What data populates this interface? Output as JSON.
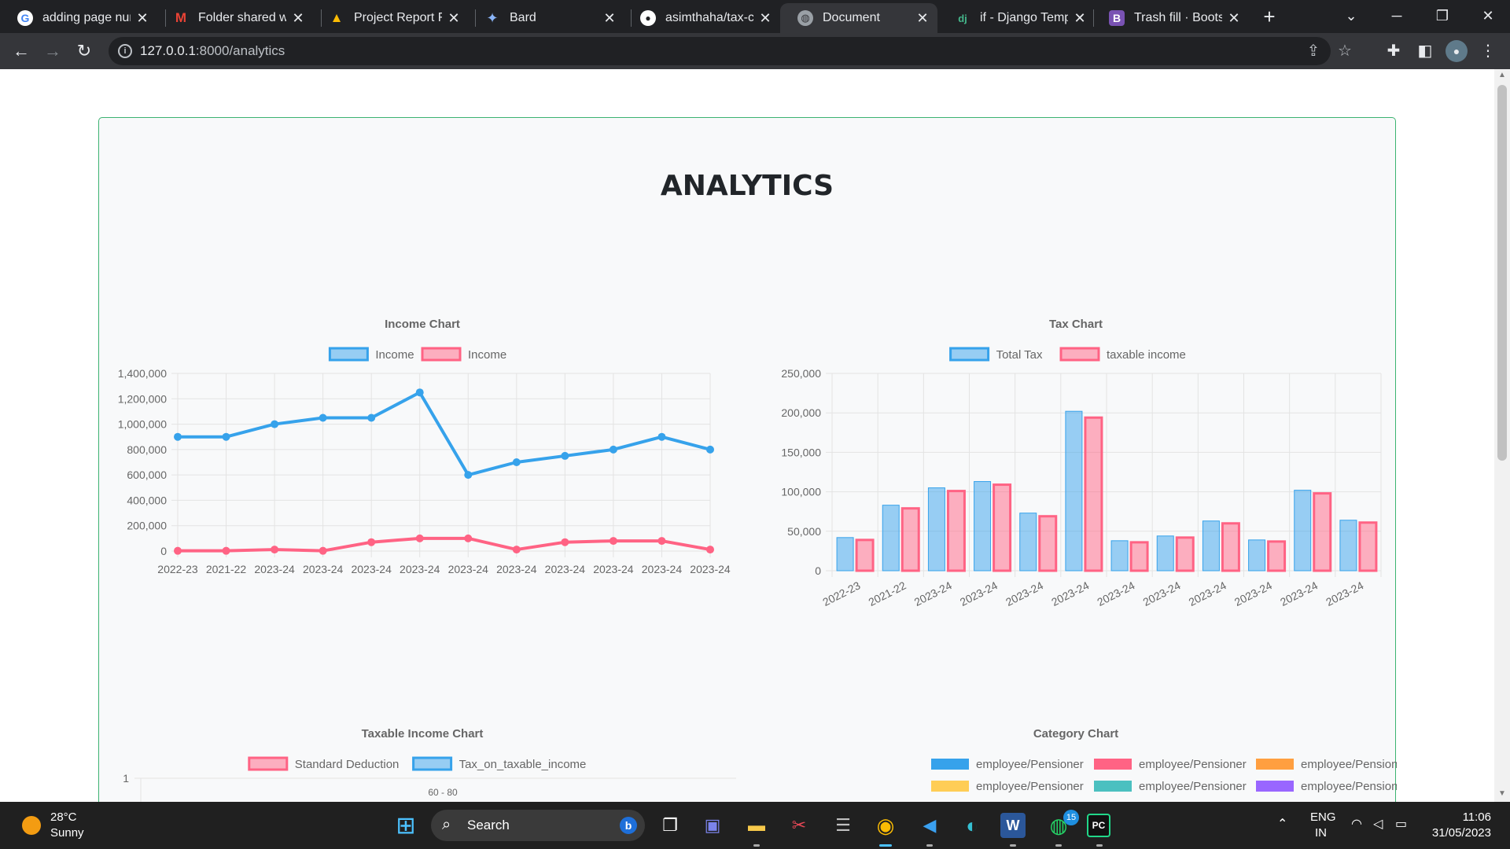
{
  "browser": {
    "tabs": [
      {
        "title": "adding page num",
        "favicon": "google-icon"
      },
      {
        "title": "Folder shared wit",
        "favicon": "gmail-icon"
      },
      {
        "title": "Project Report Fo",
        "favicon": "google-drive-icon"
      },
      {
        "title": "Bard",
        "favicon": "bard-icon"
      },
      {
        "title": "asimthaha/tax-ca",
        "favicon": "github-icon"
      },
      {
        "title": "Document",
        "favicon": "globe-icon"
      },
      {
        "title": "if - Django Templ",
        "favicon": "django-icon"
      },
      {
        "title": "Trash fill · Bootstr",
        "favicon": "bootstrap-icon"
      }
    ],
    "active_tab": 5,
    "url_host": "127.0.0.1",
    "url_path": ":8000/analytics"
  },
  "page": {
    "title": "ANALYTICS"
  },
  "charts": {
    "chart_data": [
      {
        "type": "line",
        "title": "Income Chart",
        "categories": [
          "2022-23",
          "2021-22",
          "2023-24",
          "2023-24",
          "2023-24",
          "2023-24",
          "2023-24",
          "2023-24",
          "2023-24",
          "2023-24",
          "2023-24",
          "2023-24"
        ],
        "series": [
          {
            "name": "Income",
            "color": "#36a2eb",
            "values": [
              900000,
              900000,
              1000000,
              1050000,
              1050000,
              1250000,
              600000,
              700000,
              750000,
              800000,
              900000,
              800000
            ]
          },
          {
            "name": "Income",
            "color": "#ff6384",
            "values": [
              2000,
              2000,
              12000,
              2000,
              70000,
              100000,
              100000,
              12000,
              70000,
              80000,
              80000,
              12000
            ]
          }
        ],
        "ylim": [
          0,
          1400000
        ],
        "yticks": [
          "1,400,000",
          "1,200,000",
          "1,000,000",
          "800,000",
          "600,000",
          "400,000",
          "200,000",
          "0"
        ],
        "legend": "top",
        "grid": true
      },
      {
        "type": "bar",
        "title": "Tax Chart",
        "categories": [
          "2022-23",
          "2021-22",
          "2023-24",
          "2023-24",
          "2023-24",
          "2023-24",
          "2023-24",
          "2023-24",
          "2023-24",
          "2023-24",
          "2023-24",
          "2023-24"
        ],
        "series": [
          {
            "name": "Total Tax",
            "color": "#36a2eb",
            "values": [
              42000,
              83000,
              105000,
              113000,
              73000,
              202000,
              38000,
              44000,
              63000,
              39000,
              102000,
              64000
            ]
          },
          {
            "name": "taxable income",
            "color": "#ff6384",
            "values": [
              39000,
              79000,
              101000,
              109000,
              69000,
              194000,
              36000,
              42000,
              60000,
              37000,
              98000,
              61000
            ]
          }
        ],
        "ylim": [
          0,
          250000
        ],
        "yticks": [
          "250,000",
          "200,000",
          "150,000",
          "100,000",
          "50,000",
          "0"
        ],
        "legend": "top",
        "grid": true
      },
      {
        "type": "bar",
        "title": "Taxable Income Chart",
        "categories": [
          "60 - 80"
        ],
        "series": [
          {
            "name": "Standard Deduction",
            "color": "#ff6384"
          },
          {
            "name": "Tax_on_taxable_income",
            "color": "#36a2eb"
          }
        ],
        "yticks": [
          "1"
        ],
        "legend": "top"
      },
      {
        "type": "pie",
        "title": "Category Chart",
        "legend_items": [
          {
            "name": "employee/Pensioner",
            "color": "#36a2eb"
          },
          {
            "name": "employee/Pensioner",
            "color": "#ff6384"
          },
          {
            "name": "employee/Pensioner",
            "color": "#ff9f40"
          },
          {
            "name": "employee/Pensioner",
            "color": "#ffcd56"
          },
          {
            "name": "employee/Pensioner",
            "color": "#4bc0c0"
          },
          {
            "name": "employee/Pensioner",
            "color": "#9966ff"
          }
        ],
        "legend": "top"
      }
    ]
  },
  "taskbar": {
    "weather_temp": "28°C",
    "weather_condition": "Sunny",
    "search_label": "Search",
    "whatsapp_badge": "15",
    "lang_line1": "ENG",
    "lang_line2": "IN",
    "time": "11:06",
    "date": "31/05/2023"
  }
}
